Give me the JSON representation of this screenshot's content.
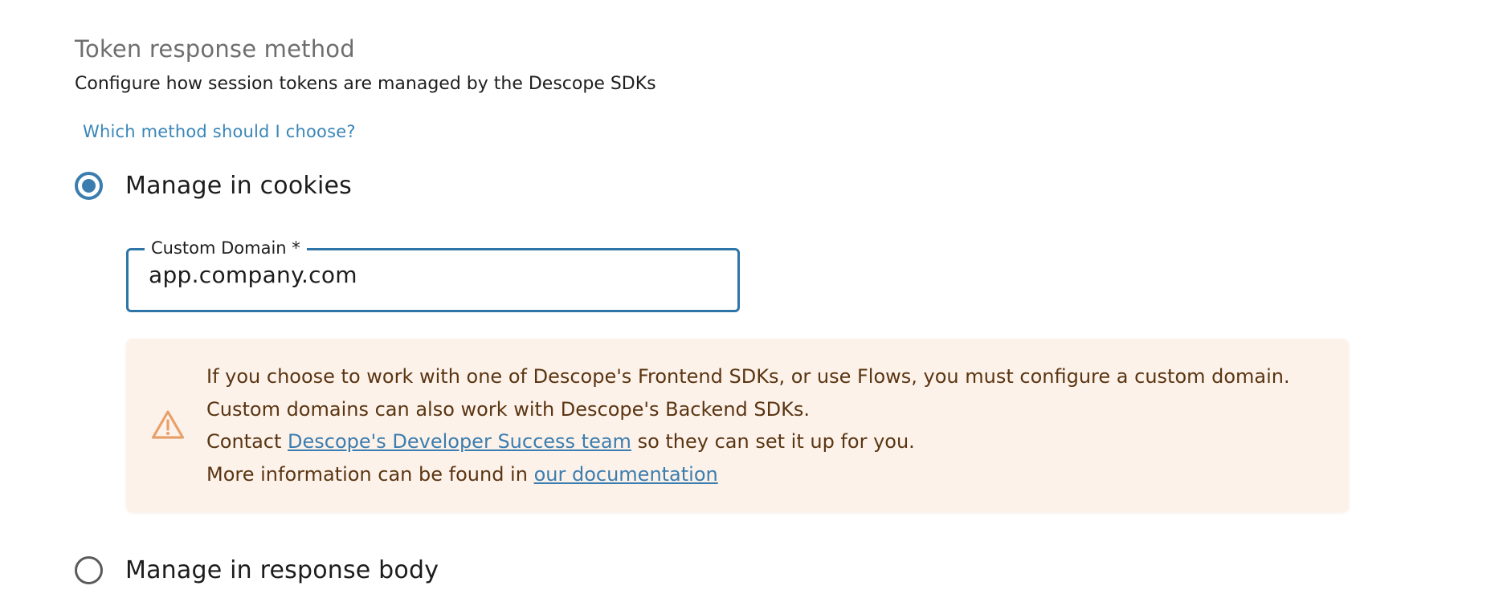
{
  "section": {
    "title": "Token response method",
    "description": "Configure how session tokens are managed by the Descope SDKs",
    "help_link": "Which method should I choose?"
  },
  "options": {
    "cookies": {
      "label": "Manage in cookies",
      "selected": true
    },
    "response_body": {
      "label": "Manage in response body",
      "selected": false
    }
  },
  "custom_domain": {
    "label": "Custom Domain *",
    "value": "app.company.com"
  },
  "alert": {
    "icon": "warning-triangle-icon",
    "line1": "If you choose to work with one of Descope's Frontend SDKs, or use Flows, you must configure a custom domain.",
    "line2": "Custom domains can also work with Descope's Backend SDKs.",
    "line3_prefix": "Contact ",
    "line3_link": "Descope's Developer Success team",
    "line3_suffix": " so they can set it up for you.",
    "line4_prefix": "More information can be found in ",
    "line4_link": "our documentation"
  },
  "colors": {
    "accent": "#3b7dae",
    "link": "#3a86b8",
    "alert_background": "#fdf2ea",
    "alert_text": "#5a3512",
    "warning_icon": "#e8a06a"
  }
}
